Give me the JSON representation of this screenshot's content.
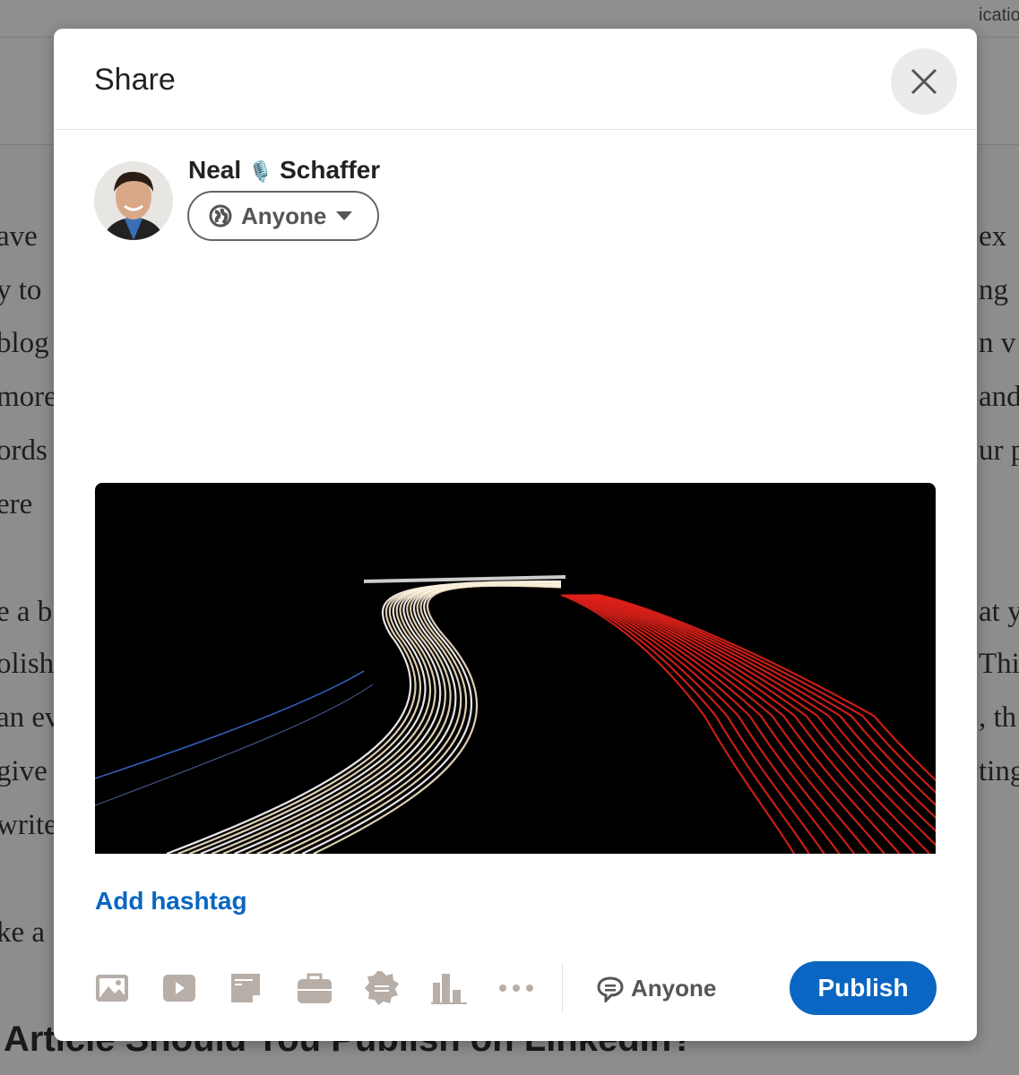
{
  "background": {
    "left_fragments": [
      "ave",
      "y to",
      "blog",
      "more",
      "ords",
      "ere",
      "e a b",
      "olish",
      "an ev",
      "give",
      "write",
      "ke a"
    ],
    "right_fragments": [
      "ex",
      "ng",
      "n v",
      "and",
      "ur p",
      "at y",
      "Thi",
      ", th",
      "ting"
    ],
    "nav_fragment": "icatio",
    "heading": "Article Should You Publish on LinkedIn?"
  },
  "modal": {
    "title": "Share",
    "close_icon": "close-icon",
    "user": {
      "name_first": "Neal",
      "name_emoji": "🎙️",
      "name_last": "Schaffer"
    },
    "audience": {
      "label": "Anyone",
      "icon": "globe-icon"
    },
    "image_alt": "Long-exposure light trails on a curving highway at night",
    "add_hashtag": "Add hashtag",
    "toolbar": [
      "photo-icon",
      "video-icon",
      "document-icon",
      "job-icon",
      "celebrate-icon",
      "poll-icon",
      "more-icon"
    ],
    "comment_visibility": {
      "label": "Anyone",
      "icon": "comment-icon"
    },
    "publish": "Publish"
  },
  "colors": {
    "accent": "#0a66c2",
    "icon": "#b7aea7"
  }
}
